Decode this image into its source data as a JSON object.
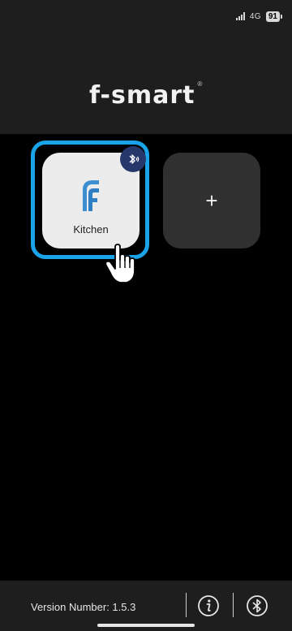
{
  "status_bar": {
    "network": "4G",
    "battery": "91"
  },
  "header": {
    "logo_text": "f-smart",
    "logo_mark": "®"
  },
  "devices": [
    {
      "name": "Kitchen",
      "icon": "f-logo-icon",
      "badge_icon": "bluetooth-signal-icon"
    }
  ],
  "add_button": {
    "label": "+"
  },
  "footer": {
    "version_label": "Version Number: 1.5.3",
    "info_icon": "info-icon",
    "bluetooth_icon": "bluetooth-icon"
  },
  "colors": {
    "accent": "#1aa3e8",
    "badge": "#26386b",
    "header_bg": "#1e1e1e",
    "card_bg": "#ececec",
    "add_card_bg": "#303030"
  }
}
